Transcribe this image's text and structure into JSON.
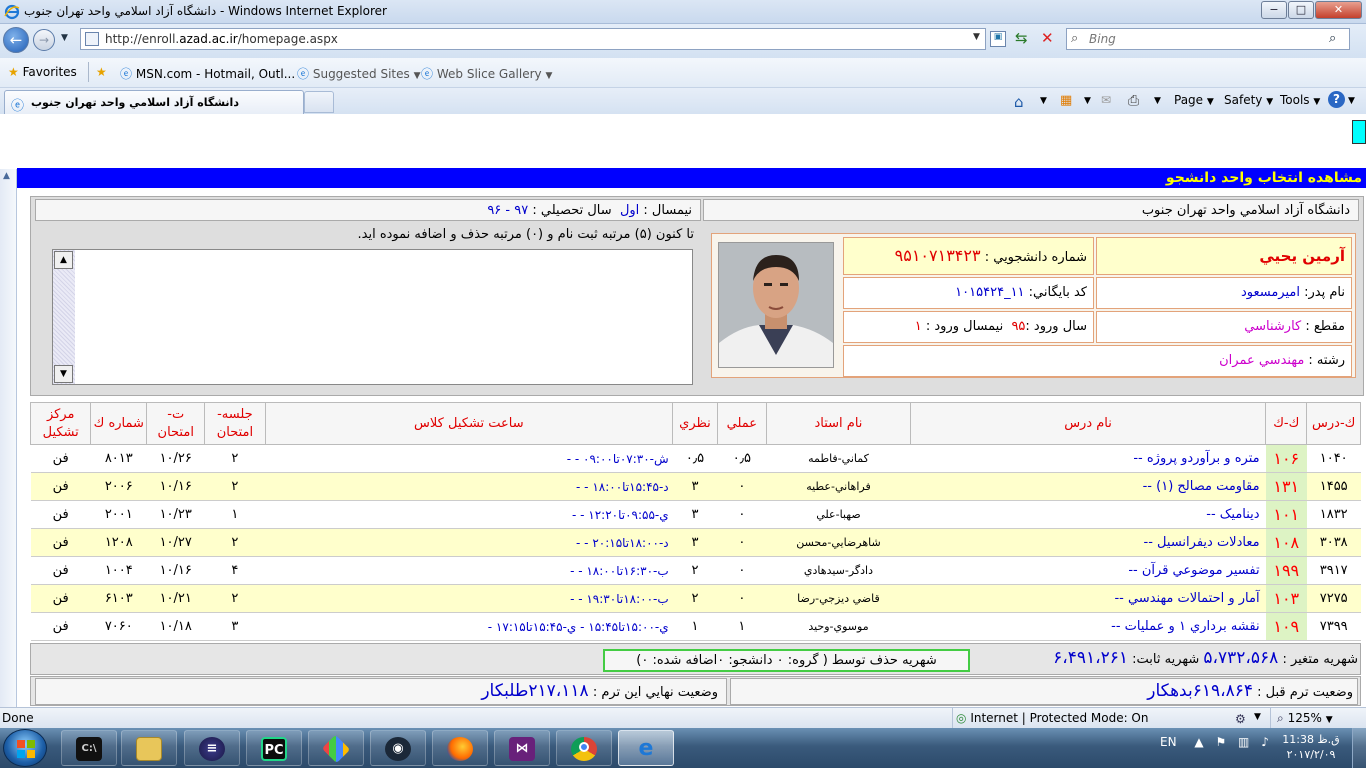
{
  "window": {
    "title": "دانشگاه آزاد اسلامي واحد تهران جنوب - Windows Internet Explorer"
  },
  "nav": {
    "url_prefix": "http://enroll.",
    "url_domain": "azad.ac.ir",
    "url_path": "/homepage.aspx",
    "search_placeholder": "Bing"
  },
  "favorites": {
    "label": "Favorites",
    "items": [
      "MSN.com - Hotmail, Outl...",
      "Suggested Sites",
      "Web Slice Gallery"
    ]
  },
  "tab": {
    "title": "دانشگاه آزاد اسلامي واحد تهران جنوب"
  },
  "commands": {
    "page": "Page",
    "safety": "Safety",
    "tools": "Tools"
  },
  "page": {
    "header": "مشاهده انتخاب واحد دانشجو",
    "university": "دانشگاه آزاد اسلامي واحد تهران جنوب",
    "term_label": "نيمسال :",
    "term_value": "اول",
    "year_label": "سال تحصيلي :",
    "year_value": "۹۷ - ۹۶",
    "reg_text": "تا كنون (۵) مرتبه ثبت نام و (۰) مرتبه حذف و اضافه نموده ايد.",
    "student": {
      "name": "آرمين يحيي",
      "id_label": "شماره دانشجويي :",
      "id": "۹۵۱۰۷۱۳۴۲۳",
      "father_label": "نام پدر:",
      "father": "اميرمسعود",
      "archive_label": "كد بايگاني:",
      "archive": "۱۱_۱۰۱۵۴۲۴",
      "level_label": "مقطع :",
      "level": "كارشناسي",
      "entry_label": "سال ورود :",
      "entry_year": "۹۵",
      "entry_term_label": "نيمسال ورود :",
      "entry_term": "۱",
      "major_label": "رشته :",
      "major": "مهندسي عمران"
    },
    "table": {
      "headers": [
        "ك-درس",
        "ك-ك",
        "نام درس",
        "نام استاد",
        "عملي",
        "نظري",
        "ساعت تشكيل كلاس",
        "جلسه- امتحان",
        "ت- امتحان",
        "شماره ك",
        "مركز تشكيل"
      ],
      "rows": [
        [
          "۱۰۴۰",
          "۱۰۶",
          "متره و برآوردو پروژه --",
          "كماني-فاطمه",
          "۰٫۵",
          "۰٫۵",
          "ش-۰۷:۳۰تا۰۹:۰۰ - -",
          "۲",
          "۱۰/۲۶",
          "۸۰۱۳",
          "فن"
        ],
        [
          "۱۴۵۵",
          "۱۳۱",
          "مقاومت مصالح (۱) --",
          "فراهاني-عطيه",
          "۰",
          "۳",
          "د-۱۵:۴۵تا۱۸:۰۰ - -",
          "۲",
          "۱۰/۱۶",
          "۲۰۰۶",
          "فن"
        ],
        [
          "۱۸۳۲",
          "۱۰۱",
          "ديناميک --",
          "صهبا-علي",
          "۰",
          "۳",
          "ي-۰۹:۵۵تا۱۲:۲۰ - -",
          "۱",
          "۱۰/۲۳",
          "۲۰۰۱",
          "فن"
        ],
        [
          "۳۰۳۸",
          "۱۰۸",
          "معادلات ديفرانسيل --",
          "شاهرضايي-محسن",
          "۰",
          "۳",
          "د-۱۸:۰۰تا۲۰:۱۵ - -",
          "۲",
          "۱۰/۲۷",
          "۱۲۰۸",
          "فن"
        ],
        [
          "۳۹۱۷",
          "۱۹۹",
          "تفسير موضوعي قرآن --",
          "دادگر-سيدهادي",
          "۰",
          "۲",
          "ب-۱۶:۳۰تا۱۸:۰۰ - -",
          "۴",
          "۱۰/۱۶",
          "۱۰۰۴",
          "فن"
        ],
        [
          "۷۲۷۵",
          "۱۰۳",
          "آمار و احتمالات مهندسي --",
          "قاضي ديزجي-رضا",
          "۰",
          "۲",
          "ب-۱۸:۰۰تا۱۹:۳۰ - -",
          "۲",
          "۱۰/۲۱",
          "۶۱۰۳",
          "فن"
        ],
        [
          "۷۳۹۹",
          "۱۰۹",
          "نقشه برداري ۱ و عمليات --",
          "موسوي-وحيد",
          "۱",
          "۱",
          "ي-۱۵:۰۰تا۱۵:۴۵ - ي-۱۵:۴۵تا۱۷:۱۵ -",
          "۳",
          "۱۰/۱۸",
          "۷۰۶۰",
          "فن"
        ]
      ]
    },
    "fees": {
      "variable_label": "شهريه متغير :",
      "variable": "۵،۷۳۲،۵۶۸",
      "fixed_label": "شهريه ثابت:",
      "fixed": "۶،۴۹۱،۲۶۱",
      "avg_text": "شهريه حذف توسط ( گروه: ۰ دانشجو: ۰اضافه شده: ۰)"
    },
    "status": {
      "prev_label": "وضعيت ترم قبل :",
      "prev": "۶۱۹،۸۶۴بدهكار",
      "final_label": "وضعيت نهايي اين ترم :",
      "final": "۲۱۷،۱۱۸طلبكار"
    }
  },
  "statusbar": {
    "left": "Done",
    "zone": "Internet | Protected Mode: On",
    "zoom": "125%"
  },
  "taskbar": {
    "lang": "EN",
    "time": "ق.ظ 11:38",
    "date": "۲۰۱۷/۲/۰۹"
  },
  "colors": {
    "header_bg": "#0000ff",
    "header_text": "#ffff00",
    "link_blue": "#0000cc",
    "red": "#e00000",
    "row_alt": "#ffffcc",
    "group_cell": "#ddf3c4"
  }
}
